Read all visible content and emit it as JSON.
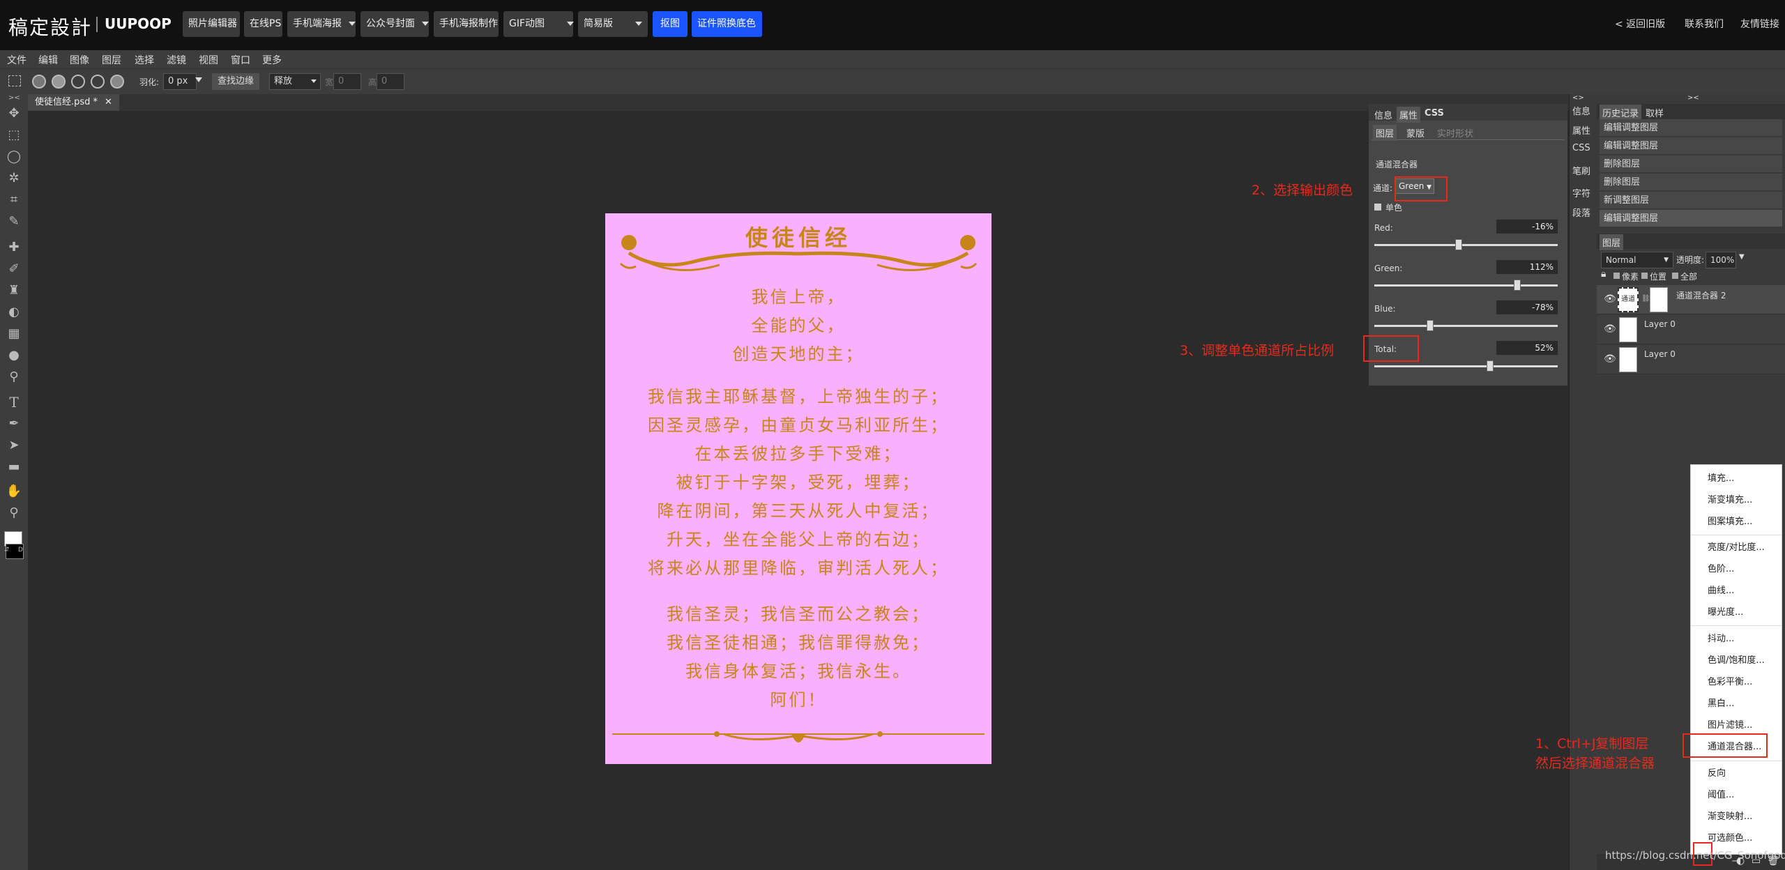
{
  "topnav": {
    "logo": "稿定設計",
    "brand": "UUPOOP",
    "buttons": [
      {
        "label": "照片编辑器"
      },
      {
        "label": "在线PS"
      },
      {
        "label": "手机端海报"
      },
      {
        "label": "公众号封面"
      },
      {
        "label": "手机海报制作"
      },
      {
        "label": "GIF动图"
      },
      {
        "label": "简易版"
      },
      {
        "label": "抠图"
      },
      {
        "label": "证件照换底色"
      }
    ],
    "links": [
      "< 返回旧版",
      "联系我们",
      "友情链接"
    ]
  },
  "menubar": [
    "文件",
    "编辑",
    "图像",
    "图层",
    "选择",
    "滤镜",
    "视图",
    "窗口",
    "更多"
  ],
  "options": {
    "feather_label": "羽化:",
    "feather_value": "0",
    "feather_unit": "px",
    "refine_edge": "查找边缘",
    "style_value": "释放",
    "width_label": "宽",
    "width_value": "0",
    "height_label": "高",
    "height_value": "0"
  },
  "document": {
    "tab_title": "使徒信经.psd *"
  },
  "poster": {
    "title": "使徒信经",
    "lines": [
      "我信上帝，",
      "全能的父，",
      "创造天地的主；",
      "我信我主耶稣基督，上帝独生的子；",
      "因圣灵感孕，由童贞女马利亚所生；",
      "在本丢彼拉多手下受难；",
      "被钉于十字架，受死，埋葬；",
      "降在阴间，第三天从死人中复活；",
      "升天，坐在全能父上帝的右边；",
      "将来必从那里降临，审判活人死人；",
      "我信圣灵；我信圣而公之教会；",
      "我信圣徒相通；我信罪得赦免；",
      "我信身体复活；我信永生。",
      "阿们！"
    ]
  },
  "properties": {
    "tabs": [
      "信息",
      "属性",
      "CSS"
    ],
    "subtabs": [
      "图层",
      "蒙版",
      "实时形状"
    ],
    "heading": "通道混合器",
    "channel_label": "通道:",
    "channel_value": "Green",
    "mono_label": "单色",
    "sliders": [
      {
        "label": "Red:",
        "value": "-16%",
        "level": -16
      },
      {
        "label": "Green:",
        "value": "112%",
        "level": 112
      },
      {
        "label": "Blue:",
        "value": "-78%",
        "level": -78
      },
      {
        "label": "Total:",
        "value": "52%",
        "level": 52
      }
    ]
  },
  "sidecol": [
    "信息",
    "属性",
    "CSS",
    "笔刷",
    "字符",
    "段落"
  ],
  "history": {
    "tabs": [
      "历史记录",
      "取样"
    ],
    "items": [
      "编辑调整图层",
      "编辑调整图层",
      "删除图层",
      "删除图层",
      "新调整图层",
      "编辑调整图层"
    ]
  },
  "layers": {
    "title": "图层",
    "blend_mode": "Normal",
    "opacity_label": "透明度:",
    "opacity_value": "100%",
    "lock_labels": [
      "像素",
      "位置",
      "全部"
    ],
    "items": [
      {
        "name": "通道混合器 2",
        "thumb": "通道"
      },
      {
        "name": "Layer 0"
      },
      {
        "name": "Layer 0"
      }
    ]
  },
  "context_menu": {
    "groups": [
      [
        "填充...",
        "渐变填充...",
        "图案填充..."
      ],
      [
        "亮度/对比度...",
        "色阶...",
        "曲线...",
        "曝光度..."
      ],
      [
        "抖动...",
        "色调/饱和度...",
        "色彩平衡...",
        "黑白...",
        "图片滤镜...",
        "通道混合器..."
      ],
      [
        "反向",
        "阈值...",
        "渐变映射...",
        "可选颜色..."
      ]
    ]
  },
  "annotations": {
    "step1_line1": "1、Ctrl+J复制图层",
    "step1_line2": "然后选择通道混合器",
    "step2": "2、选择输出颜色",
    "step3": "3、调整单色通道所占比例"
  },
  "watermark": "https://blog.csdn.net/CG_Sonofgod",
  "colors": {
    "accent": "#1a55ff",
    "annotation": "#e8291c",
    "poster_bg": "#f9b0ff",
    "poster_text": "#c8861a"
  }
}
